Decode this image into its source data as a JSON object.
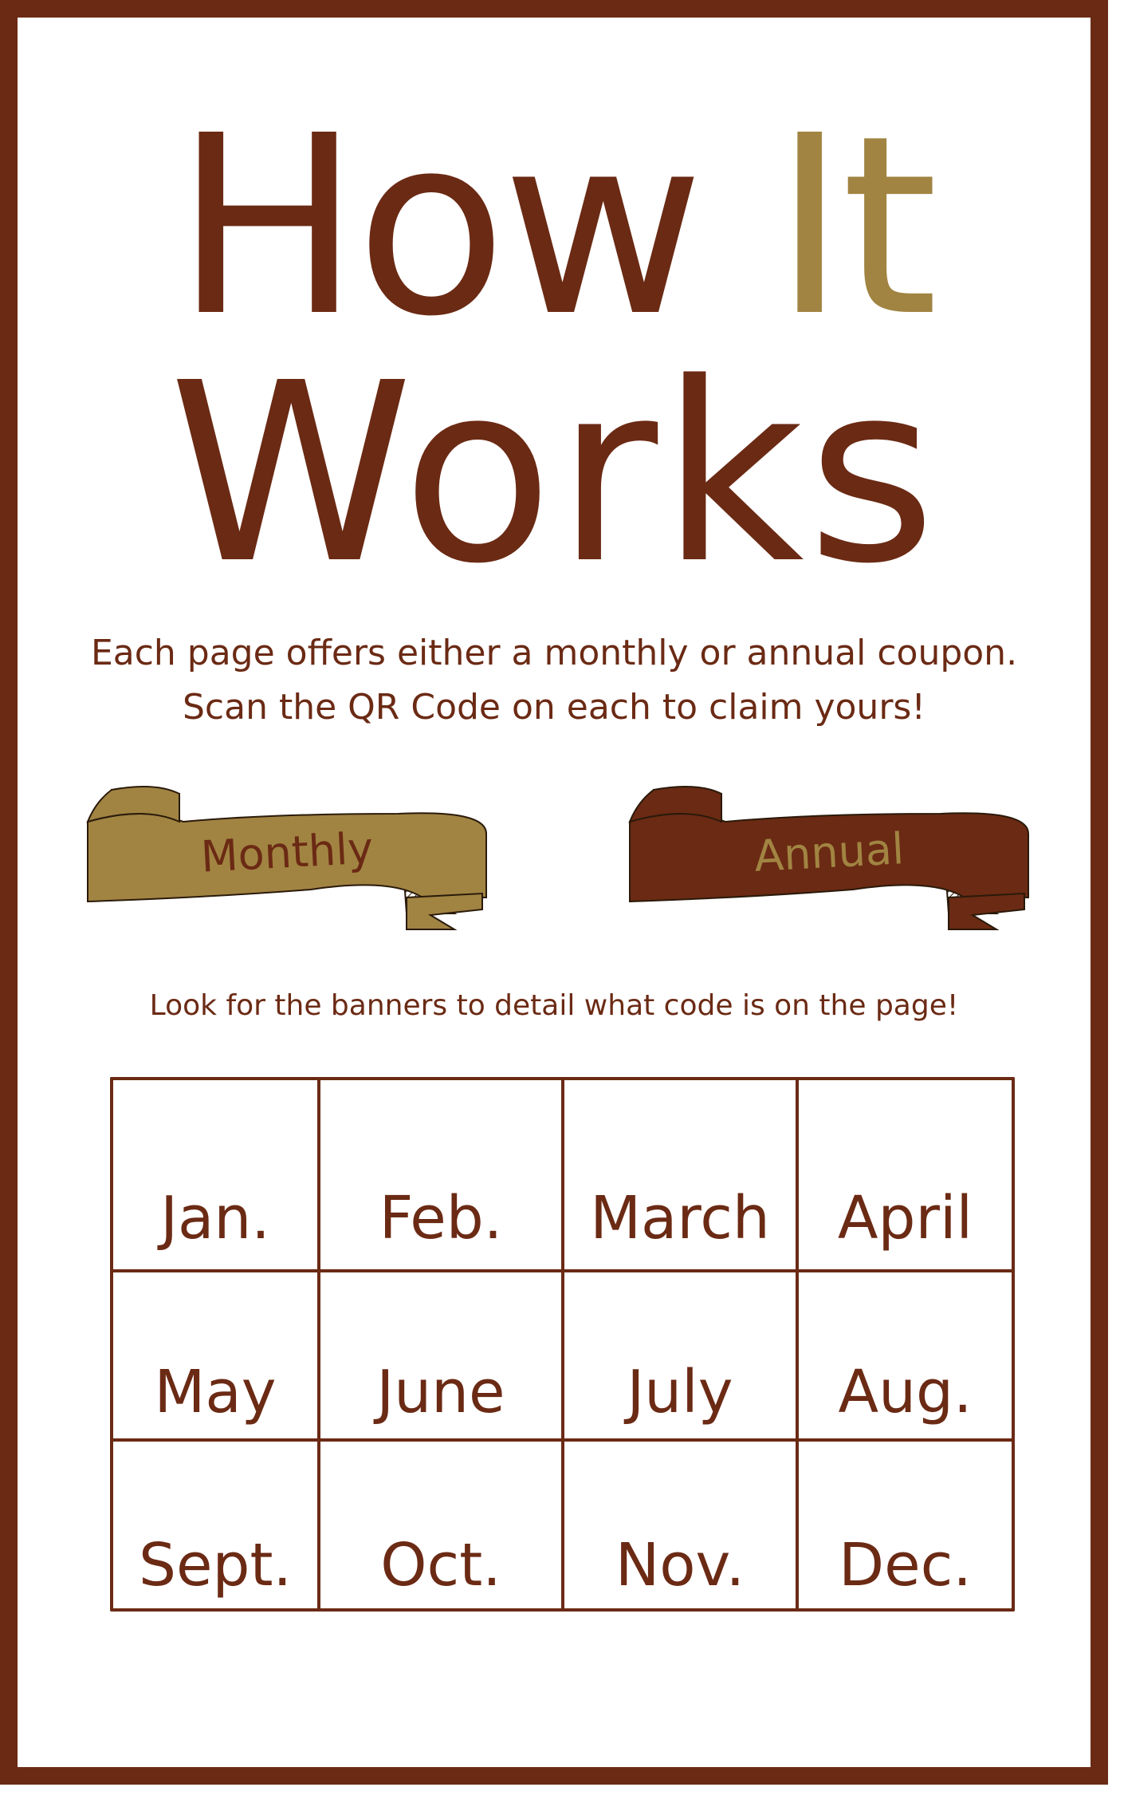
{
  "title": {
    "word1": "How",
    "word2": "It",
    "word3": "Works"
  },
  "intro": {
    "line1": "Each page offers either a monthly or annual coupon.",
    "line2": "Scan the QR Code on each to claim yours!"
  },
  "banners": {
    "monthly": "Monthly",
    "annual": "Annual"
  },
  "hint": "Look for the banners to detail what code is on the page!",
  "months": [
    "Jan.",
    "Feb.",
    "March",
    "April",
    "May",
    "June",
    "July",
    "Aug.",
    "Sept.",
    "Oct.",
    "Nov.",
    "Dec."
  ],
  "colors": {
    "primary": "#6b2a14",
    "accent": "#a18442",
    "background": "#ffffff"
  }
}
